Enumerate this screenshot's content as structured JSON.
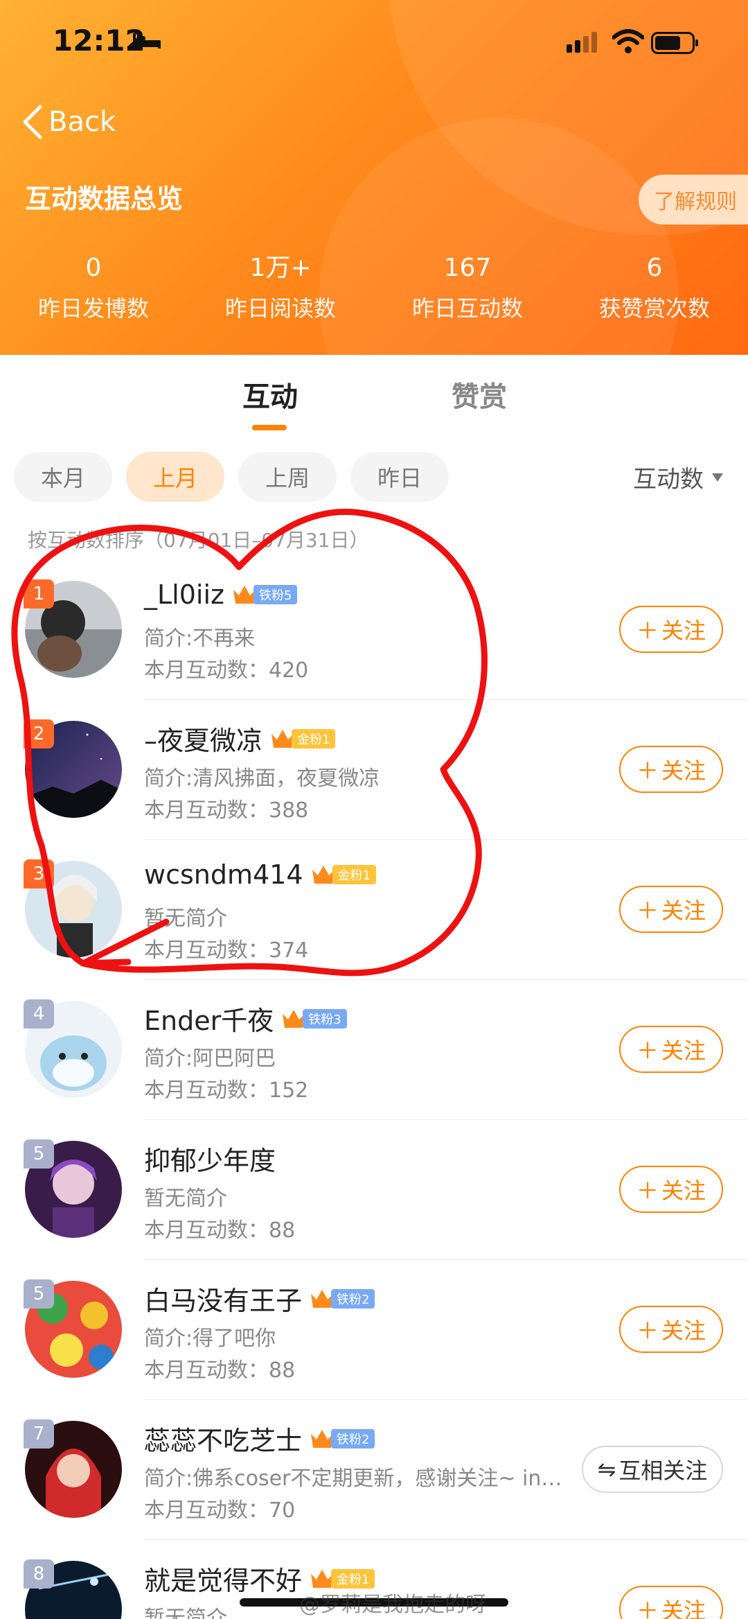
{
  "status_bar": {
    "time": "12:12"
  },
  "header": {
    "back_label": "Back",
    "title": "互动数据总览",
    "rules_button": "了解规则",
    "stats": [
      {
        "value": "0",
        "label": "昨日发博数"
      },
      {
        "value": "1万+",
        "label": "昨日阅读数"
      },
      {
        "value": "167",
        "label": "昨日互动数"
      },
      {
        "value": "6",
        "label": "获赞赏次数"
      }
    ]
  },
  "tabs": {
    "active": "互动",
    "inactive": "赞赏"
  },
  "filters": {
    "chips": [
      "本月",
      "上月",
      "上周",
      "昨日"
    ],
    "selected": "上月",
    "sort_label": "互动数"
  },
  "hint": "按互动数排序（07月01日–07月31日）",
  "rows": [
    {
      "rank": "1",
      "name": "_Ll0iiz",
      "badge_type": "iron",
      "badge_label": "铁粉5",
      "bio": "简介:不再来",
      "count_label": "本月互动数：420",
      "button": "关注"
    },
    {
      "rank": "2",
      "name": "–夜夏微凉",
      "badge_type": "gold",
      "badge_label": "金粉1",
      "bio": "简介:清风拂面，夜夏微凉",
      "count_label": "本月互动数：388",
      "button": "关注"
    },
    {
      "rank": "3",
      "name": "wcsndm414",
      "badge_type": "gold",
      "badge_label": "金粉1",
      "bio": "暂无简介",
      "count_label": "本月互动数：374",
      "button": "关注"
    },
    {
      "rank": "4",
      "name": "Ender千夜",
      "badge_type": "iron",
      "badge_label": "铁粉3",
      "bio": "简介:阿巴阿巴",
      "count_label": "本月互动数：152",
      "button": "关注"
    },
    {
      "rank": "5",
      "name": "抑郁少年度",
      "badge_type": "",
      "badge_label": "",
      "bio": "暂无简介",
      "count_label": "本月互动数：88",
      "button": "关注"
    },
    {
      "rank": "5",
      "name": "白马没有王子",
      "badge_type": "iron",
      "badge_label": "铁粉2",
      "bio": "简介:得了吧你",
      "count_label": "本月互动数：88",
      "button": "关注"
    },
    {
      "rank": "7",
      "name": "蕊蕊不吃芝士",
      "badge_type": "iron",
      "badge_label": "铁粉2",
      "bio": "简介:佛系coser不定期更新，感谢关注~ ins...",
      "count_label": "本月互动数：70",
      "button": "互相关注"
    },
    {
      "rank": "8",
      "name": "就是觉得不好",
      "badge_type": "gold",
      "badge_label": "金粉1",
      "bio": "暂无简介",
      "count_label": "",
      "button": "关注"
    }
  ],
  "watermark": "@罗莉是我抱走的呀"
}
